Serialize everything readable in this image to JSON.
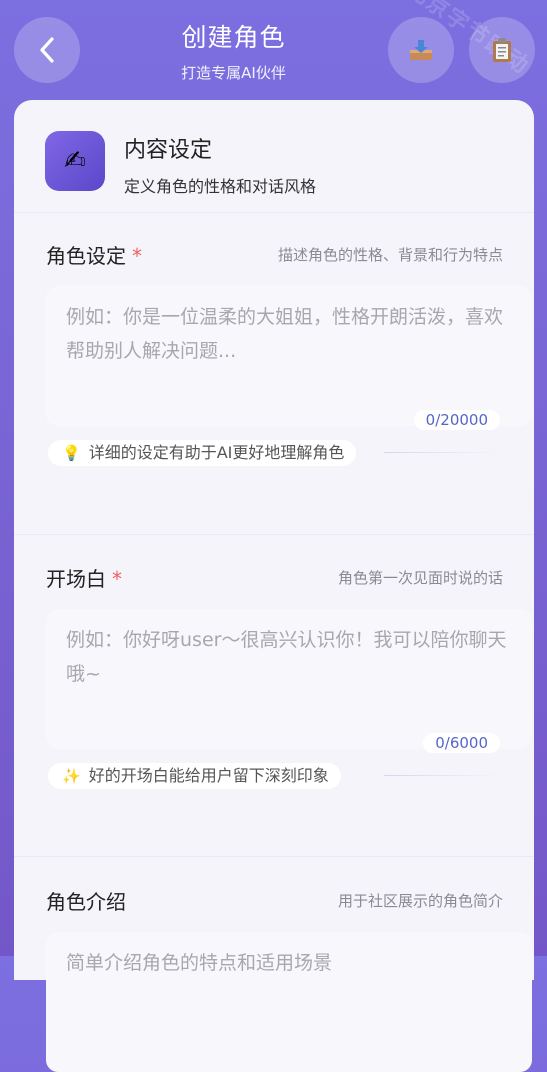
{
  "header": {
    "title": "创建角色",
    "subtitle": "打造专属AI伙伴",
    "watermark": "北京字节跳动"
  },
  "content_card": {
    "title": "内容设定",
    "subtitle": "定义角色的性格和对话风格"
  },
  "sections": [
    {
      "label": "角色设定",
      "required_mark": "*",
      "hint": "描述角色的性格、背景和行为特点",
      "placeholder": "例如：你是一位温柔的大姐姐，性格开朗活泼，喜欢帮助别人解决问题...",
      "counter": "0/20000",
      "tip": "详细的设定有助于AI更好地理解角色"
    },
    {
      "label": "开场白",
      "required_mark": "*",
      "hint": "角色第一次见面时说的话",
      "placeholder": "例如：你好呀user～很高兴认识你！我可以陪你聊天哦~",
      "counter": "0/6000",
      "tip": "好的开场白能给用户留下深刻印象"
    },
    {
      "label": "角色介绍",
      "hint": "用于社区展示的角色简介",
      "placeholder": "简单介绍角色的特点和适用场景"
    }
  ],
  "icons": {
    "back": "chevron-left-icon",
    "import": "inbox-tray-icon",
    "copy": "clipboard-icon",
    "content": "writing-hand-icon",
    "tip1": "lightbulb-icon",
    "tip2": "sparkles-icon"
  },
  "colors": {
    "accent": "#7a66d6",
    "required": "#f26060",
    "counter": "#5566c8"
  }
}
